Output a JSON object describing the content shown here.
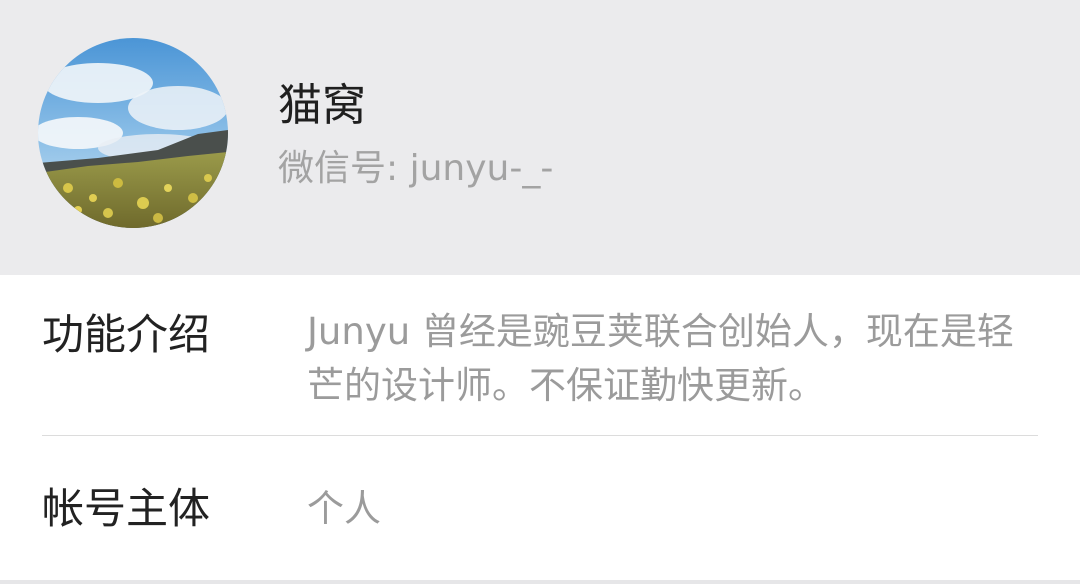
{
  "profile": {
    "avatar_icon": "landscape-avatar-icon",
    "name": "猫窝",
    "wechat_id": "微信号: junyu-_-"
  },
  "details": {
    "intro_label": "功能介绍",
    "intro_value": "Junyu 曾经是豌豆荚联合创始人，现在是轻芒的设计师。不保证勤快更新。",
    "entity_label": "帐号主体",
    "entity_value": "个人"
  },
  "colors": {
    "header_bg": "#ebebed",
    "card_bg": "#ffffff",
    "primary_text": "#222222",
    "secondary_text": "#9b9b9b"
  }
}
